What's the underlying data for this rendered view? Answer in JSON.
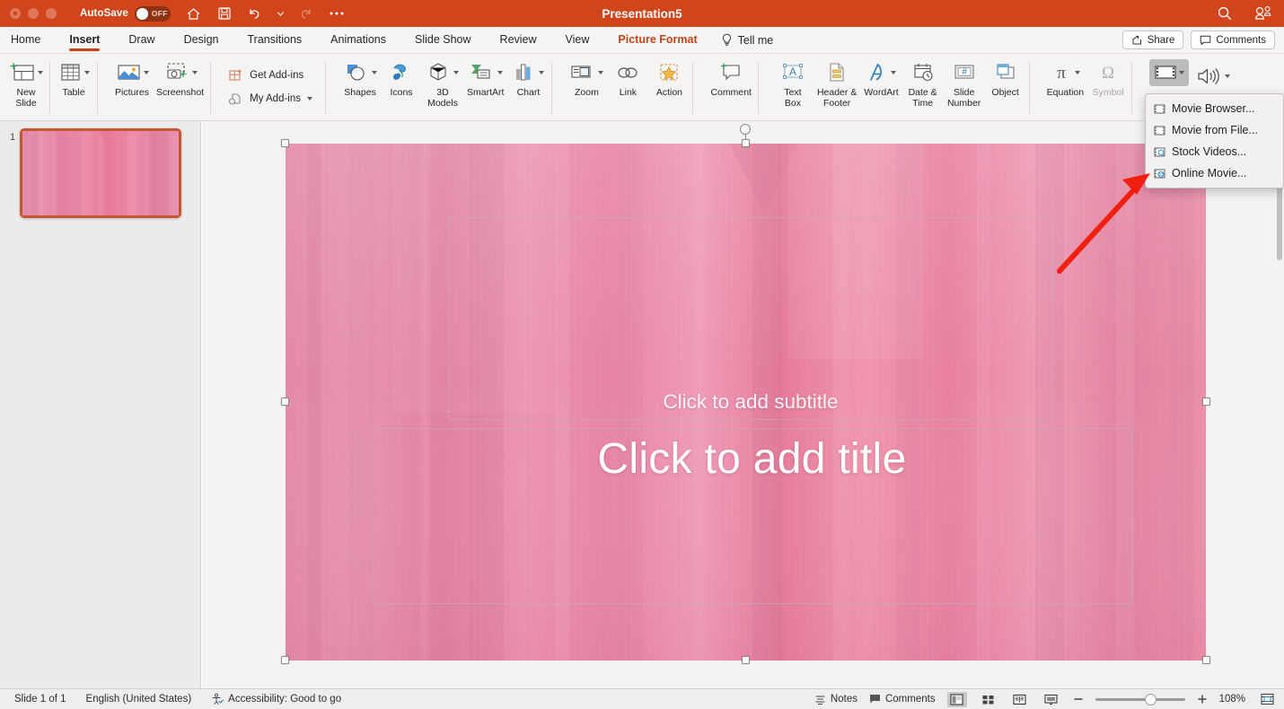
{
  "window": {
    "title": "Presentation5",
    "autosave_label": "AutoSave",
    "autosave_state": "OFF",
    "accent_color": "#d0451b",
    "titlebar_icons": [
      "home-icon",
      "save-icon",
      "undo-icon",
      "undo-caret-icon",
      "redo-icon",
      "more-icon"
    ],
    "right_icons": [
      "search-icon",
      "account-icon"
    ]
  },
  "tabs": {
    "items": [
      {
        "label": "Home",
        "active": false,
        "contextual": false
      },
      {
        "label": "Insert",
        "active": true,
        "contextual": false
      },
      {
        "label": "Draw",
        "active": false,
        "contextual": false
      },
      {
        "label": "Design",
        "active": false,
        "contextual": false
      },
      {
        "label": "Transitions",
        "active": false,
        "contextual": false
      },
      {
        "label": "Animations",
        "active": false,
        "contextual": false
      },
      {
        "label": "Slide Show",
        "active": false,
        "contextual": false
      },
      {
        "label": "Review",
        "active": false,
        "contextual": false
      },
      {
        "label": "View",
        "active": false,
        "contextual": false
      },
      {
        "label": "Picture Format",
        "active": false,
        "contextual": true
      }
    ],
    "tell_me": "Tell me",
    "share": "Share",
    "comments": "Comments"
  },
  "ribbon": {
    "groups": [
      {
        "items": [
          {
            "label": "New\nSlide",
            "icon": "new-slide-icon",
            "caret": true
          },
          {
            "label": "Table",
            "icon": "table-icon",
            "caret": true
          }
        ]
      },
      {
        "items": [
          {
            "label": "Pictures",
            "icon": "pictures-icon",
            "caret": true
          },
          {
            "label": "Screenshot",
            "icon": "screenshot-icon",
            "caret": true
          }
        ]
      },
      {
        "addins": [
          {
            "label": "Get Add-ins",
            "icon": "get-addins-icon",
            "caret": false
          },
          {
            "label": "My Add-ins",
            "icon": "my-addins-icon",
            "caret": true
          }
        ]
      },
      {
        "items": [
          {
            "label": "Shapes",
            "icon": "shapes-icon",
            "caret": true
          },
          {
            "label": "Icons",
            "icon": "icons-icon",
            "caret": false
          },
          {
            "label": "3D\nModels",
            "icon": "3d-models-icon",
            "caret": true
          },
          {
            "label": "SmartArt",
            "icon": "smartart-icon",
            "caret": true
          },
          {
            "label": "Chart",
            "icon": "chart-icon",
            "caret": true
          }
        ]
      },
      {
        "items": [
          {
            "label": "Zoom",
            "icon": "zoom-icon",
            "caret": true
          },
          {
            "label": "Link",
            "icon": "link-icon",
            "caret": false
          },
          {
            "label": "Action",
            "icon": "action-icon",
            "caret": false
          }
        ]
      },
      {
        "items": [
          {
            "label": "Comment",
            "icon": "comment-icon",
            "caret": false
          }
        ]
      },
      {
        "items": [
          {
            "label": "Text\nBox",
            "icon": "text-box-icon",
            "caret": false
          },
          {
            "label": "Header &\nFooter",
            "icon": "header-footer-icon",
            "caret": false
          },
          {
            "label": "WordArt",
            "icon": "wordart-icon",
            "caret": true
          },
          {
            "label": "Date &\nTime",
            "icon": "date-time-icon",
            "caret": false
          },
          {
            "label": "Slide\nNumber",
            "icon": "slide-number-icon",
            "caret": false
          },
          {
            "label": "Object",
            "icon": "object-icon",
            "caret": false
          }
        ]
      },
      {
        "items": [
          {
            "label": "Equation",
            "icon": "equation-icon",
            "caret": true
          },
          {
            "label": "Symbol",
            "icon": "symbol-icon",
            "caret": false,
            "disabled": true
          }
        ]
      },
      {
        "items": [
          {
            "label": "",
            "icon": "video-icon",
            "caret": true,
            "highlight": true
          },
          {
            "label": "",
            "icon": "audio-icon",
            "caret": true
          }
        ]
      }
    ]
  },
  "video_menu": {
    "items": [
      {
        "label": "Movie Browser...",
        "icon": "movie-browser-icon"
      },
      {
        "label": "Movie from File...",
        "icon": "movie-file-icon"
      },
      {
        "label": "Stock Videos...",
        "icon": "stock-videos-icon"
      },
      {
        "label": "Online Movie...",
        "icon": "online-movie-icon"
      }
    ],
    "highlighted_target": "Online Movie..."
  },
  "thumbnails": {
    "slides": [
      {
        "number": "1",
        "selected": true
      }
    ]
  },
  "slide": {
    "subtitle_placeholder": "Click to add subtitle",
    "title_placeholder": "Click to add title",
    "picture_selected": true,
    "background_color": "#e9829f"
  },
  "annotation": {
    "arrow_color": "#f02010",
    "points_to": "Online Movie..."
  },
  "statusbar": {
    "slide_count": "Slide 1 of 1",
    "language": "English (United States)",
    "accessibility": "Accessibility: Good to go",
    "notes": "Notes",
    "comments": "Comments",
    "zoom_level": "108%",
    "views": [
      "normal-view-icon",
      "slide-sorter-icon",
      "reading-view-icon",
      "slideshow-icon"
    ],
    "active_view": "normal-view-icon"
  }
}
